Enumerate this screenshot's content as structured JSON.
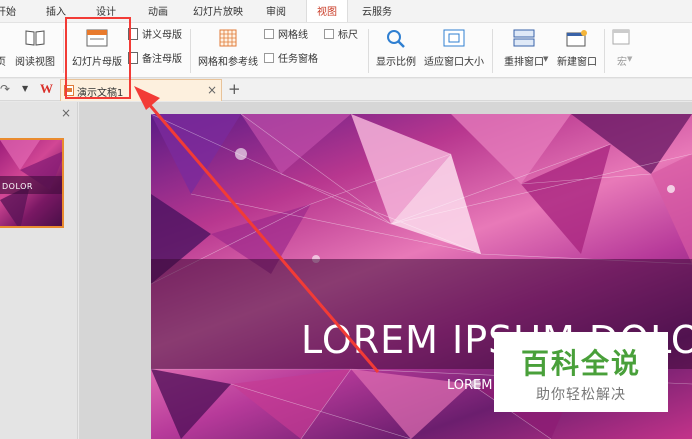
{
  "menu": {
    "tabs": [
      {
        "label": "开始"
      },
      {
        "label": "插入"
      },
      {
        "label": "设计"
      },
      {
        "label": "动画"
      },
      {
        "label": "幻灯片放映"
      },
      {
        "label": "审阅"
      },
      {
        "label": "视图"
      },
      {
        "label": "云服务"
      }
    ],
    "active": "视图"
  },
  "ribbon": {
    "page_partial": "页",
    "reading_view": "阅读视图",
    "slide_master": "幻灯片母版",
    "handout_master": "讲义母版",
    "notes_master": "备注母版",
    "grid_guides": "网格和参考线",
    "gridlines": "网格线",
    "ruler": "标尺",
    "task_pane": "任务窗格",
    "zoom": "显示比例",
    "fit_window": "适应窗口大小",
    "rearrange_window": "重排窗口",
    "new_window": "新建窗口",
    "macro": "宏"
  },
  "tabs": {
    "document": "演示文稿1",
    "close": "×",
    "new_tab": "+"
  },
  "left_pane": {
    "close": "×",
    "thumb_text": "DOLOR"
  },
  "slide": {
    "title": "LOREM IPSUM DOLOR",
    "subtitle": "LOREM IPSUM"
  },
  "watermark": {
    "title": "百科全说",
    "subtitle": "助你轻松解决"
  },
  "colors": {
    "annotation": "#f23b36",
    "active_tab": "#c93a25",
    "thumbnail_border": "#e98b2f",
    "watermark_green": "#49a03a"
  }
}
